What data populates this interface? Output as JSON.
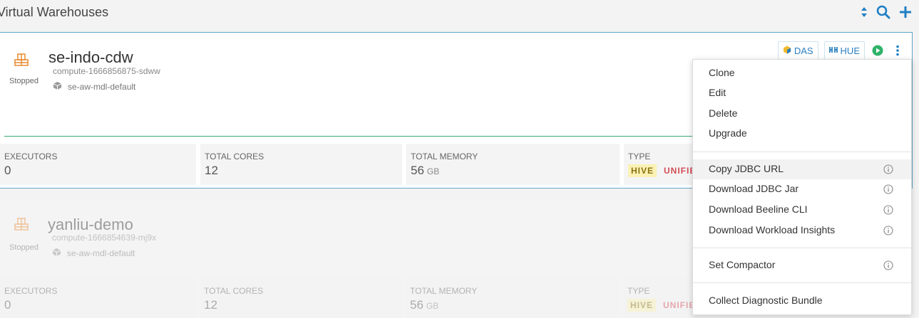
{
  "header": {
    "title": "Virtual Warehouses",
    "icons": [
      "sort-icon",
      "search-icon",
      "plus-icon"
    ]
  },
  "warehouses": [
    {
      "name": "se-indo-cdw",
      "compute_id": "compute-1666856875-sdww",
      "environment": "se-aw-mdl-default",
      "status": "Stopped",
      "actions": {
        "das_label": "DAS",
        "hue_label": "HUE"
      },
      "progress": 1.0,
      "stats": {
        "executors_label": "EXECUTORS",
        "executors_value": "0",
        "cores_label": "TOTAL CORES",
        "cores_value": "12",
        "memory_label": "TOTAL MEMORY",
        "memory_value": "56",
        "memory_unit": "GB",
        "type_label": "TYPE",
        "type_tags": [
          "HIVE",
          "UNIFIE"
        ]
      }
    },
    {
      "name": "yanliu-demo",
      "compute_id": "compute-1666854639-mj9x",
      "environment": "se-aw-mdl-default",
      "status": "Stopped",
      "stats": {
        "executors_label": "EXECUTORS",
        "executors_value": "0",
        "cores_label": "TOTAL CORES",
        "cores_value": "12",
        "memory_label": "TOTAL MEMORY",
        "memory_value": "56",
        "memory_unit": "GB",
        "type_label": "TYPE",
        "type_tags": [
          "HIVE",
          "UNIFIE"
        ]
      }
    }
  ],
  "menu": {
    "clone": "Clone",
    "edit": "Edit",
    "delete": "Delete",
    "upgrade": "Upgrade",
    "copy_jdbc": "Copy JDBC URL",
    "download_jdbc": "Download JDBC Jar",
    "download_beeline": "Download Beeline CLI",
    "download_insights": "Download Workload Insights",
    "set_compactor": "Set Compactor",
    "collect_bundle": "Collect Diagnostic Bundle",
    "hovered_item": "copy_jdbc"
  },
  "colors": {
    "accent": "#1f7fc4",
    "warehouse_icon": "#e88a2e",
    "run": "#2fb26a",
    "progress": "#3aa76d",
    "card_border": "#5fa6c8"
  }
}
